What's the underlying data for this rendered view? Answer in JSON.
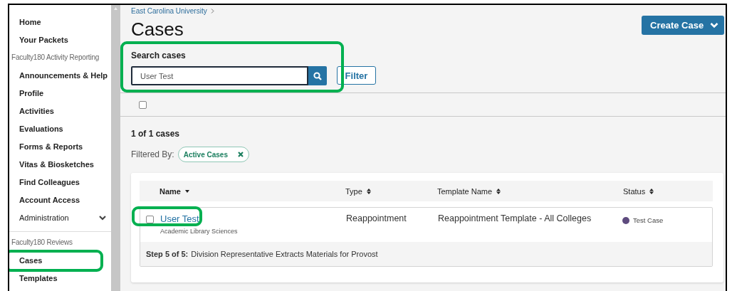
{
  "sidebar": {
    "items": [
      {
        "kind": "link",
        "label": "Home",
        "highlighted": false
      },
      {
        "kind": "link",
        "label": "Your Packets",
        "highlighted": false
      },
      {
        "kind": "header",
        "label": "Faculty180 Activity Reporting"
      },
      {
        "kind": "link",
        "label": "Announcements & Help",
        "highlighted": false
      },
      {
        "kind": "link",
        "label": "Profile",
        "highlighted": false
      },
      {
        "kind": "link",
        "label": "Activities",
        "highlighted": false
      },
      {
        "kind": "link",
        "label": "Evaluations",
        "highlighted": false
      },
      {
        "kind": "link",
        "label": "Forms & Reports",
        "highlighted": false
      },
      {
        "kind": "link",
        "label": "Vitas & Biosketches",
        "highlighted": false
      },
      {
        "kind": "link",
        "label": "Find Colleagues",
        "highlighted": false
      },
      {
        "kind": "link",
        "label": "Account Access",
        "highlighted": false
      },
      {
        "kind": "expandable",
        "label": "Administration",
        "expanded": false
      },
      {
        "kind": "divider"
      },
      {
        "kind": "header",
        "label": "Faculty180 Reviews"
      },
      {
        "kind": "link",
        "label": "Cases",
        "highlighted": true
      },
      {
        "kind": "link",
        "label": "Templates",
        "highlighted": false
      }
    ]
  },
  "breadcrumb": [
    "East Carolina University"
  ],
  "page_title": "Cases",
  "create_button": {
    "label": "Create Case"
  },
  "search": {
    "label": "Search cases",
    "value": "User Test",
    "highlighted": true
  },
  "filter_button": "Filter",
  "select_all": {
    "checked": false
  },
  "result_count": "1 of 1 cases",
  "filtered_by": {
    "label": "Filtered By:",
    "chips": [
      "Active Cases"
    ]
  },
  "table": {
    "columns": [
      {
        "label": "Name",
        "sorted": true
      },
      {
        "label": "Type",
        "sorted": false
      },
      {
        "label": "Template Name",
        "sorted": false
      },
      {
        "label": "Status",
        "sorted": false
      }
    ],
    "rows": [
      {
        "checked": false,
        "name": "User Test",
        "name_highlighted": true,
        "department": "Academic Library Sciences",
        "type": "Reappointment",
        "template": "Reappointment Template - All Colleges",
        "status": {
          "label": "Test Case",
          "color": "#5e4b7e"
        },
        "step_label": "Step 5 of 5:",
        "step_text": "Division Representative Extracts Materials for Provost"
      }
    ]
  }
}
